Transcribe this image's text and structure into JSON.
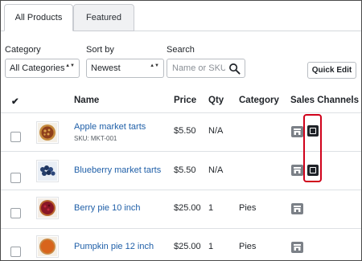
{
  "tabs": [
    {
      "label": "All Products",
      "active": true
    },
    {
      "label": "Featured",
      "active": false
    }
  ],
  "filters": {
    "category": {
      "label": "Category",
      "value": "All Categories"
    },
    "sort": {
      "label": "Sort by",
      "value": "Newest"
    },
    "search": {
      "label": "Search",
      "placeholder": "Name or SKU",
      "value": ""
    }
  },
  "quick_edit_label": "Quick Edit",
  "table": {
    "columns": {
      "select": "✔",
      "name": "Name",
      "price": "Price",
      "qty": "Qty",
      "category": "Category",
      "channels": "Sales Channels"
    },
    "rows": [
      {
        "name": "Apple market tarts",
        "sku": "SKU: MKT-001",
        "price": "$5.50",
        "qty": "N/A",
        "category": "",
        "thumb": "tart-image",
        "channels": [
          "online-store-icon",
          "square-pos-icon"
        ]
      },
      {
        "name": "Blueberry market tarts",
        "sku": "",
        "price": "$5.50",
        "qty": "N/A",
        "category": "",
        "thumb": "blueberry-image",
        "channels": [
          "online-store-icon",
          "square-pos-icon"
        ]
      },
      {
        "name": "Berry pie 10 inch",
        "sku": "",
        "price": "$25.00",
        "qty": "1",
        "category": "Pies",
        "thumb": "berry-pie-image",
        "channels": [
          "online-store-icon"
        ]
      },
      {
        "name": "Pumpkin pie 12 inch",
        "sku": "",
        "price": "$25.00",
        "qty": "1",
        "category": "Pies",
        "thumb": "pumpkin-pie-image",
        "channels": [
          "online-store-icon"
        ]
      }
    ]
  },
  "colors": {
    "link": "#1f5fa8",
    "highlight": "#d0021b"
  }
}
